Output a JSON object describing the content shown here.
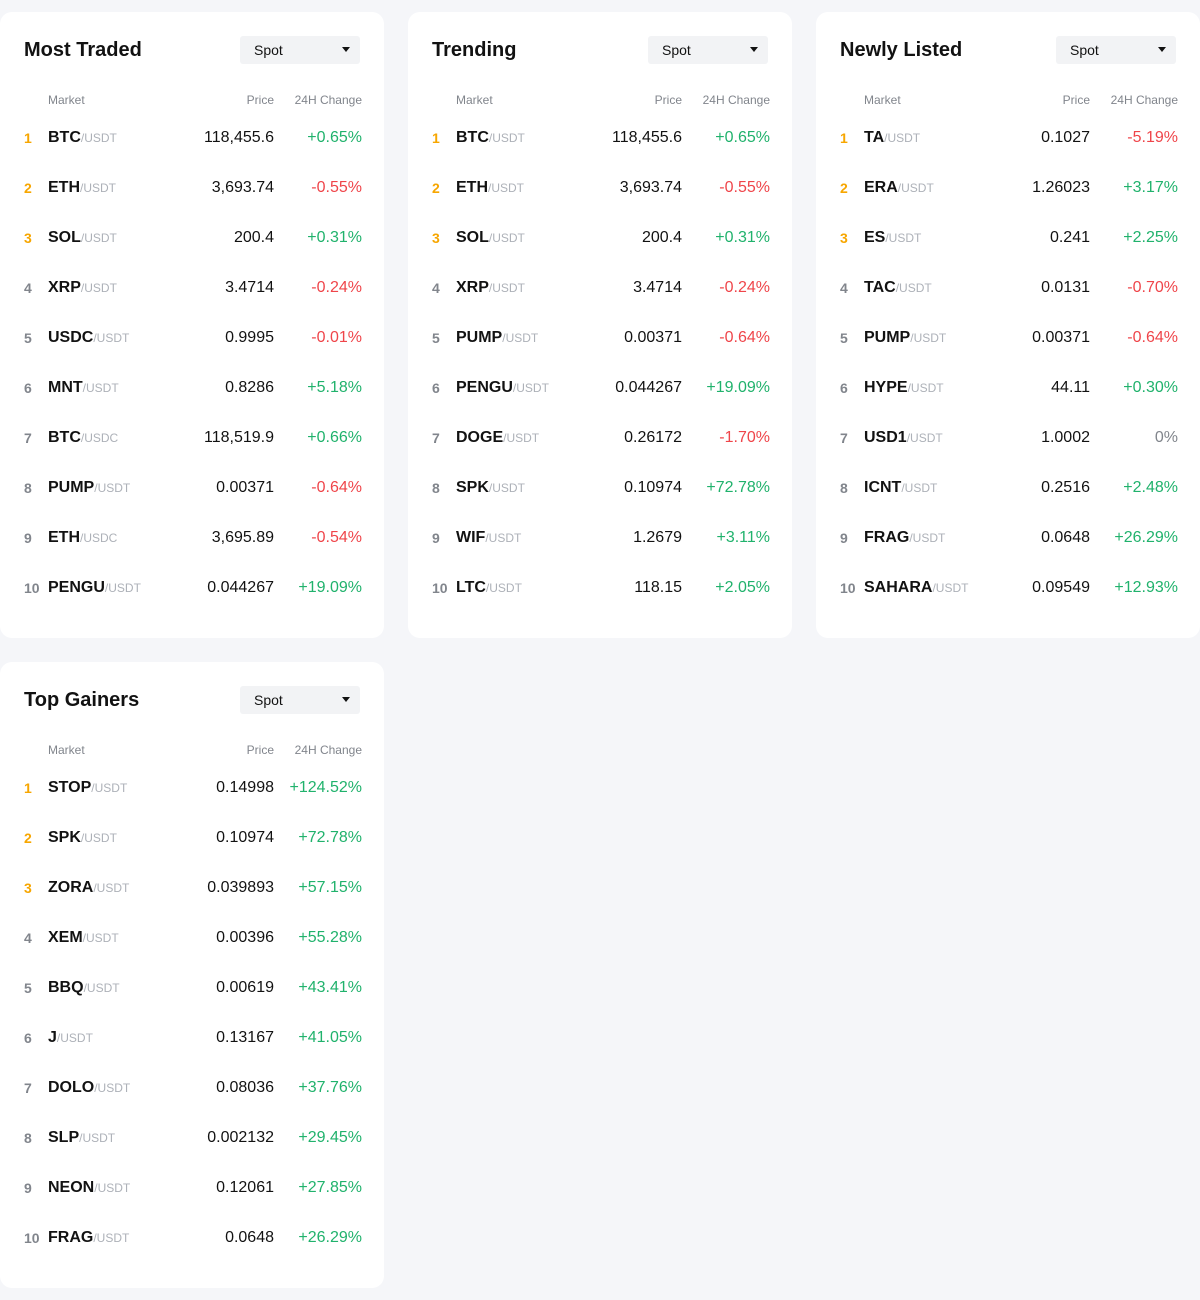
{
  "colors": {
    "up": "#20b26c",
    "down": "#ef454a",
    "flat": "#81858c",
    "rank_top": "#f7a600",
    "background": "#f5f6f9",
    "card": "#ffffff"
  },
  "icons": {
    "dropdown": "caret-down-icon"
  },
  "columns": {
    "market": "Market",
    "price": "Price",
    "change": "24H Change"
  },
  "cards": [
    {
      "title": "Most Traded",
      "filter": "Spot",
      "rows": [
        {
          "rank": "1",
          "base": "BTC",
          "quote": "/USDT",
          "price": "118,455.6",
          "change": "+0.65%",
          "dir": "up"
        },
        {
          "rank": "2",
          "base": "ETH",
          "quote": "/USDT",
          "price": "3,693.74",
          "change": "-0.55%",
          "dir": "down"
        },
        {
          "rank": "3",
          "base": "SOL",
          "quote": "/USDT",
          "price": "200.4",
          "change": "+0.31%",
          "dir": "up"
        },
        {
          "rank": "4",
          "base": "XRP",
          "quote": "/USDT",
          "price": "3.4714",
          "change": "-0.24%",
          "dir": "down"
        },
        {
          "rank": "5",
          "base": "USDC",
          "quote": "/USDT",
          "price": "0.9995",
          "change": "-0.01%",
          "dir": "down"
        },
        {
          "rank": "6",
          "base": "MNT",
          "quote": "/USDT",
          "price": "0.8286",
          "change": "+5.18%",
          "dir": "up"
        },
        {
          "rank": "7",
          "base": "BTC",
          "quote": "/USDC",
          "price": "118,519.9",
          "change": "+0.66%",
          "dir": "up"
        },
        {
          "rank": "8",
          "base": "PUMP",
          "quote": "/USDT",
          "price": "0.00371",
          "change": "-0.64%",
          "dir": "down"
        },
        {
          "rank": "9",
          "base": "ETH",
          "quote": "/USDC",
          "price": "3,695.89",
          "change": "-0.54%",
          "dir": "down"
        },
        {
          "rank": "10",
          "base": "PENGU",
          "quote": "/USDT",
          "price": "0.044267",
          "change": "+19.09%",
          "dir": "up"
        }
      ]
    },
    {
      "title": "Trending",
      "filter": "Spot",
      "rows": [
        {
          "rank": "1",
          "base": "BTC",
          "quote": "/USDT",
          "price": "118,455.6",
          "change": "+0.65%",
          "dir": "up"
        },
        {
          "rank": "2",
          "base": "ETH",
          "quote": "/USDT",
          "price": "3,693.74",
          "change": "-0.55%",
          "dir": "down"
        },
        {
          "rank": "3",
          "base": "SOL",
          "quote": "/USDT",
          "price": "200.4",
          "change": "+0.31%",
          "dir": "up"
        },
        {
          "rank": "4",
          "base": "XRP",
          "quote": "/USDT",
          "price": "3.4714",
          "change": "-0.24%",
          "dir": "down"
        },
        {
          "rank": "5",
          "base": "PUMP",
          "quote": "/USDT",
          "price": "0.00371",
          "change": "-0.64%",
          "dir": "down"
        },
        {
          "rank": "6",
          "base": "PENGU",
          "quote": "/USDT",
          "price": "0.044267",
          "change": "+19.09%",
          "dir": "up"
        },
        {
          "rank": "7",
          "base": "DOGE",
          "quote": "/USDT",
          "price": "0.26172",
          "change": "-1.70%",
          "dir": "down"
        },
        {
          "rank": "8",
          "base": "SPK",
          "quote": "/USDT",
          "price": "0.10974",
          "change": "+72.78%",
          "dir": "up"
        },
        {
          "rank": "9",
          "base": "WIF",
          "quote": "/USDT",
          "price": "1.2679",
          "change": "+3.11%",
          "dir": "up"
        },
        {
          "rank": "10",
          "base": "LTC",
          "quote": "/USDT",
          "price": "118.15",
          "change": "+2.05%",
          "dir": "up"
        }
      ]
    },
    {
      "title": "Newly Listed",
      "filter": "Spot",
      "rows": [
        {
          "rank": "1",
          "base": "TA",
          "quote": "/USDT",
          "price": "0.1027",
          "change": "-5.19%",
          "dir": "down"
        },
        {
          "rank": "2",
          "base": "ERA",
          "quote": "/USDT",
          "price": "1.26023",
          "change": "+3.17%",
          "dir": "up"
        },
        {
          "rank": "3",
          "base": "ES",
          "quote": "/USDT",
          "price": "0.241",
          "change": "+2.25%",
          "dir": "up"
        },
        {
          "rank": "4",
          "base": "TAC",
          "quote": "/USDT",
          "price": "0.0131",
          "change": "-0.70%",
          "dir": "down"
        },
        {
          "rank": "5",
          "base": "PUMP",
          "quote": "/USDT",
          "price": "0.00371",
          "change": "-0.64%",
          "dir": "down"
        },
        {
          "rank": "6",
          "base": "HYPE",
          "quote": "/USDT",
          "price": "44.11",
          "change": "+0.30%",
          "dir": "up"
        },
        {
          "rank": "7",
          "base": "USD1",
          "quote": "/USDT",
          "price": "1.0002",
          "change": "0%",
          "dir": "flat"
        },
        {
          "rank": "8",
          "base": "ICNT",
          "quote": "/USDT",
          "price": "0.2516",
          "change": "+2.48%",
          "dir": "up"
        },
        {
          "rank": "9",
          "base": "FRAG",
          "quote": "/USDT",
          "price": "0.0648",
          "change": "+26.29%",
          "dir": "up"
        },
        {
          "rank": "10",
          "base": "SAHARA",
          "quote": "/USDT",
          "price": "0.09549",
          "change": "+12.93%",
          "dir": "up"
        }
      ]
    },
    {
      "title": "Top Gainers",
      "filter": "Spot",
      "rows": [
        {
          "rank": "1",
          "base": "STOP",
          "quote": "/USDT",
          "price": "0.14998",
          "change": "+124.52%",
          "dir": "up"
        },
        {
          "rank": "2",
          "base": "SPK",
          "quote": "/USDT",
          "price": "0.10974",
          "change": "+72.78%",
          "dir": "up"
        },
        {
          "rank": "3",
          "base": "ZORA",
          "quote": "/USDT",
          "price": "0.039893",
          "change": "+57.15%",
          "dir": "up"
        },
        {
          "rank": "4",
          "base": "XEM",
          "quote": "/USDT",
          "price": "0.00396",
          "change": "+55.28%",
          "dir": "up"
        },
        {
          "rank": "5",
          "base": "BBQ",
          "quote": "/USDT",
          "price": "0.00619",
          "change": "+43.41%",
          "dir": "up"
        },
        {
          "rank": "6",
          "base": "J",
          "quote": "/USDT",
          "price": "0.13167",
          "change": "+41.05%",
          "dir": "up"
        },
        {
          "rank": "7",
          "base": "DOLO",
          "quote": "/USDT",
          "price": "0.08036",
          "change": "+37.76%",
          "dir": "up"
        },
        {
          "rank": "8",
          "base": "SLP",
          "quote": "/USDT",
          "price": "0.002132",
          "change": "+29.45%",
          "dir": "up"
        },
        {
          "rank": "9",
          "base": "NEON",
          "quote": "/USDT",
          "price": "0.12061",
          "change": "+27.85%",
          "dir": "up"
        },
        {
          "rank": "10",
          "base": "FRAG",
          "quote": "/USDT",
          "price": "0.0648",
          "change": "+26.29%",
          "dir": "up"
        }
      ]
    }
  ]
}
